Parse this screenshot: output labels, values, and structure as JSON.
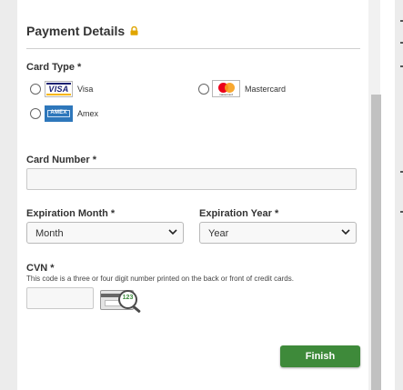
{
  "form": {
    "title": "Payment Details",
    "card_type": {
      "label": "Card Type *",
      "options": [
        {
          "brand": "VISA",
          "name": "Visa"
        },
        {
          "brand": "mastercard",
          "name": "Mastercard"
        },
        {
          "brand": "AMEX",
          "name": "Amex"
        }
      ]
    },
    "card_number": {
      "label": "Card Number *",
      "value": ""
    },
    "expiration_month": {
      "label": "Expiration Month *",
      "selected": "Month"
    },
    "expiration_year": {
      "label": "Expiration Year *",
      "selected": "Year"
    },
    "cvn": {
      "label": "CVN *",
      "hint": "This code is a three or four digit number printed on the back or front of credit cards.",
      "value": "",
      "example": "123"
    },
    "finish_label": "Finish"
  },
  "colors": {
    "accent_green": "#3e8a3a",
    "lock_gold": "#e0a500",
    "visa_blue": "#1a1f71",
    "amex_blue": "#2e77bb",
    "mastercard_red": "#eb001b",
    "mastercard_orange": "#f79e1b"
  },
  "icons": [
    "lock-icon",
    "visa-logo",
    "mastercard-logo",
    "amex-logo",
    "cvn-card-magnifier-icon",
    "chevron-down-icon"
  ]
}
